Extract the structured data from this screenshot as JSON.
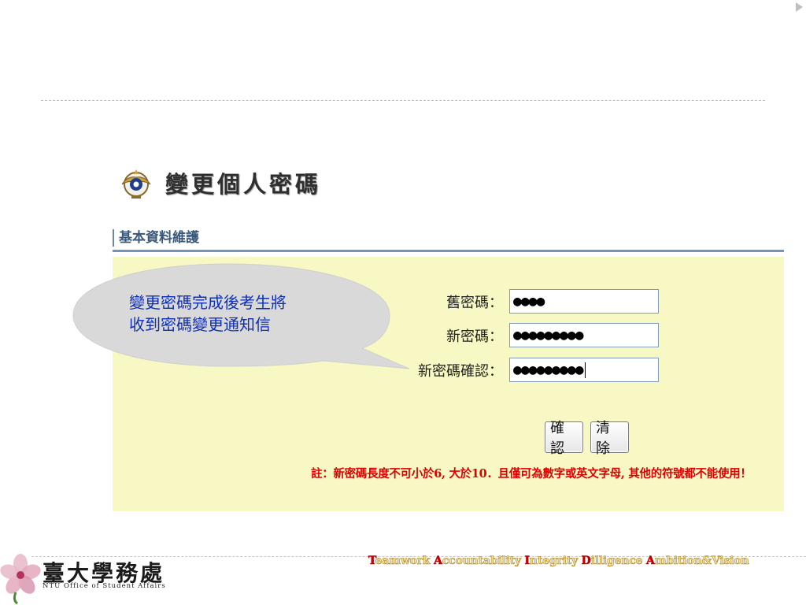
{
  "slide": {
    "title": "變更個人密碼",
    "emblem_icon": "emblem-icon"
  },
  "section": {
    "label": "基本資料維護"
  },
  "form": {
    "old_password": {
      "label": "舊密碼：",
      "value": "●●●●"
    },
    "new_password": {
      "label": "新密碼：",
      "value": "●●●●●●●●●"
    },
    "confirm_password": {
      "label": "新密碼確認：",
      "value": "●●●●●●●●●"
    },
    "confirm_button": "確認",
    "clear_button": "清除"
  },
  "note": "註：新密碼長度不可小於6, 大於10．且僅可為數字或英文字母, 其他的符號都不能使用！",
  "callout": {
    "line1": "變更密碼完成後考生將",
    "line2": "收到密碼變更通知信"
  },
  "footer": {
    "logo_zh": "臺大學務處",
    "logo_en": "NTU Office of Student Affairs",
    "motto": [
      {
        "cap": "T",
        "rest": "eamwork "
      },
      {
        "cap": "A",
        "rest": "ccountability "
      },
      {
        "cap": "I",
        "rest": "ntegrity "
      },
      {
        "cap": "D",
        "rest": "illigence "
      },
      {
        "cap": "A",
        "rest": "mbition&Vision"
      }
    ]
  },
  "colors": {
    "panel_bg": "#f8f8c4",
    "callout_fill": "#d9d9d9",
    "callout_text": "#0d2fb7",
    "note_text": "#e00000",
    "section_text": "#39587c"
  }
}
